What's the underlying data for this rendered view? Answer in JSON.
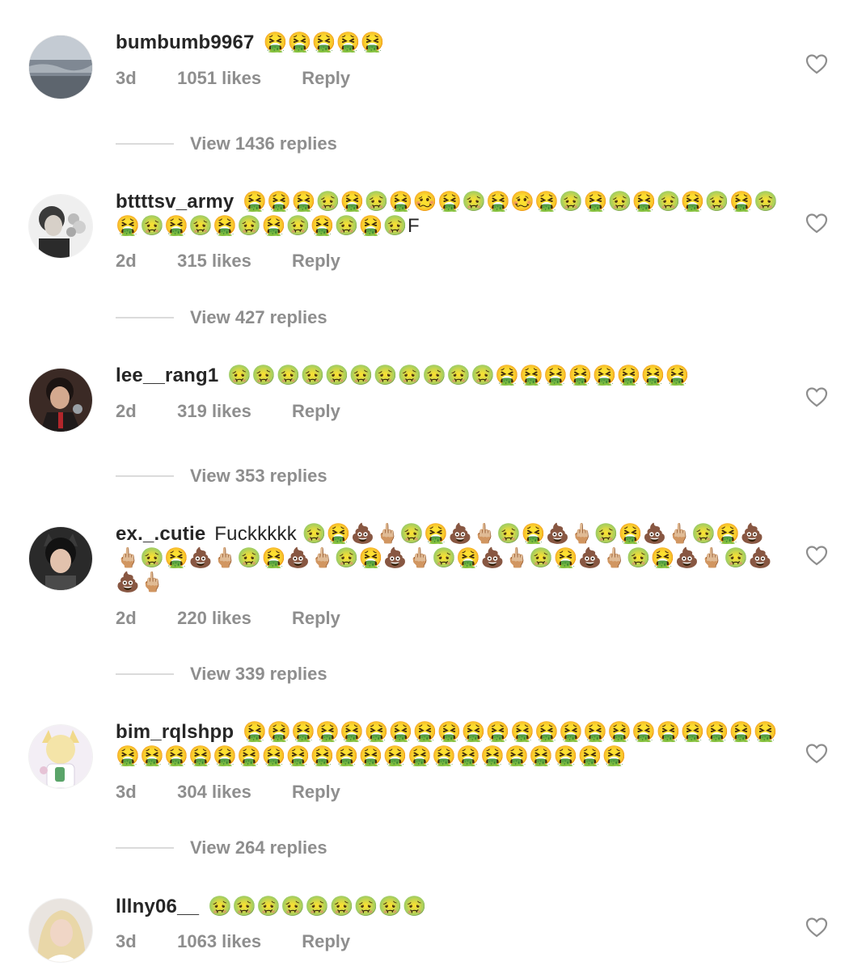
{
  "colors": {
    "username": "#262626",
    "meta": "#8e8e8e",
    "rule": "#dbdbdb",
    "heart": "#8e8e8e",
    "emoji_green": "#7cb342",
    "emoji_yellow": "#fbc02d"
  },
  "comments": [
    {
      "username": "bumbumb9967",
      "text": "🤮🤮🤮🤮🤮",
      "time": "3d",
      "likes": "1051 likes",
      "reply": "Reply",
      "view_replies": "View 1436 replies"
    },
    {
      "username": "bttttsv_army",
      "text": "🤮🤮🤮🤢🤮🤢🤮🥴🤮🤢🤮🥴🤮🤢🤮🤢🤮🤢🤮🤢🤮🤢🤮🤢🤮🤢🤮🤢🤮🤢🤮🤢🤮🤢F",
      "time": "2d",
      "likes": "315 likes",
      "reply": "Reply",
      "view_replies": "View 427 replies"
    },
    {
      "username": "lee__rang1",
      "text": "🤢🤢🤢🤢🤢🤢🤢🤢🤢🤢🤢🤮🤮🤮🤮🤮🤮🤮🤮",
      "time": "2d",
      "likes": "319 likes",
      "reply": "Reply",
      "view_replies": "View 353 replies"
    },
    {
      "username": "ex._.cutie",
      "text": "Fuckkkkk 🤢🤮💩🖕🏼🤢🤮💩🖕🏼🤢🤮💩🖕🏼🤢🤮💩🖕🏼🤢🤮💩🖕🏼🤢🤮💩🖕🏼🤢🤮💩🖕🏼🤢🤮💩🖕🏼🤢🤮💩🖕🏼🤢🤮💩🖕🏼🤢🤮💩🖕🏼🤢💩💩🖕🏼",
      "time": "2d",
      "likes": "220 likes",
      "reply": "Reply",
      "view_replies": "View 339 replies"
    },
    {
      "username": "bim_rqlshpp",
      "text": "🤮🤮🤮🤮🤮🤮🤮🤮🤮🤮🤮🤮🤮🤮🤮🤮🤮🤮🤮🤮🤮🤮🤮🤮🤮🤮🤮🤮🤮🤮🤮🤮🤮🤮🤮🤮🤮🤮🤮🤮🤮🤮🤮",
      "time": "3d",
      "likes": "304 likes",
      "reply": "Reply",
      "view_replies": "View 264 replies"
    },
    {
      "username": "lllny06__",
      "text": "🤢🤢🤢🤢🤢🤢🤢🤢🤢",
      "time": "3d",
      "likes": "1063 likes",
      "reply": "Reply"
    }
  ]
}
